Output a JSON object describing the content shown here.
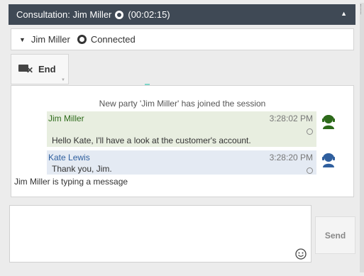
{
  "header": {
    "title": "Consultation: Jim Miller",
    "timer": "(00:02:15)",
    "collapse_icon": "caret-up-icon"
  },
  "party": {
    "name": "Jim Miller",
    "status": "Connected",
    "caret_icon": "caret-down-icon",
    "status_icon": "connected-status-icon"
  },
  "toolbar": {
    "end_label": "End",
    "end_icon": "end-chat-icon"
  },
  "transcript": {
    "system_message": "New party 'Jim Miller' has joined the session",
    "messages": [
      {
        "author": "Jim Miller",
        "time": "3:28:02 PM",
        "text": "Hello Kate, I'll have a look at the customer's account.",
        "avatar_icon": "agent-headset-icon",
        "author_color": "#2d6a1a"
      },
      {
        "author": "Kate Lewis",
        "time": "3:28:20 PM",
        "text": "Thank you, Jim.",
        "avatar_icon": "agent-headset-icon",
        "author_color": "#2f5f9e"
      }
    ],
    "typing_status": "Jim Miller is typing a message"
  },
  "compose": {
    "value": "",
    "placeholder": "",
    "emoji_icon": "smiley-icon"
  },
  "send": {
    "label": "Send"
  },
  "colors": {
    "header_bg": "#3f4955",
    "agent1_bubble": "#e8eee0",
    "agent2_bubble": "#e4eaf3",
    "agent1_avatar": "#2d6a1a",
    "agent2_avatar": "#2f5f9e"
  }
}
